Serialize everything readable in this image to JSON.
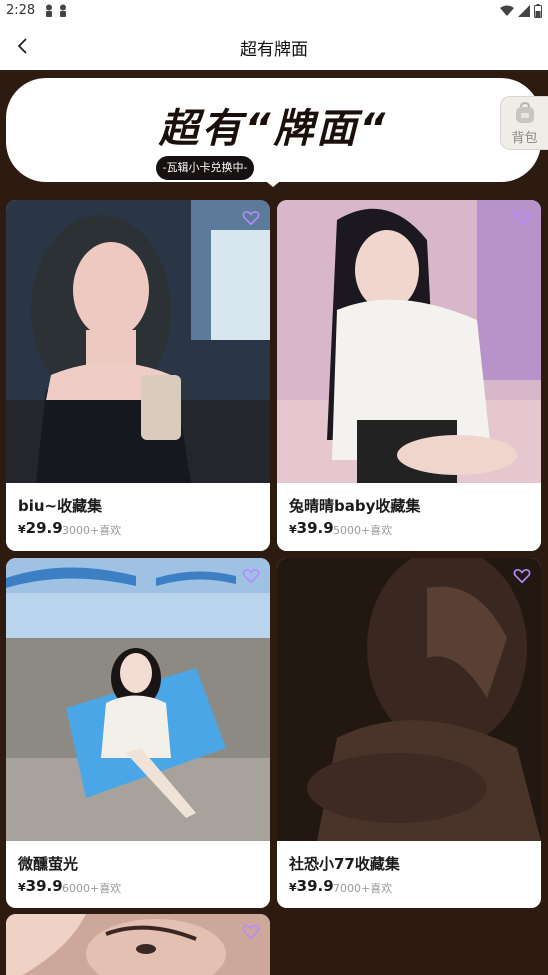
{
  "status": {
    "time": "2:28"
  },
  "header": {
    "title": "超有牌面"
  },
  "banner": {
    "title": "超有“牌面“",
    "pill": "-瓦辑小卡兑换中-"
  },
  "backpack": {
    "label": "背包"
  },
  "products": [
    {
      "name": "biu~收藏集",
      "currency": "¥",
      "price": "29.9",
      "likes": "3000+喜欢"
    },
    {
      "name": "兔晴晴baby收藏集",
      "currency": "¥",
      "price": "39.9",
      "likes": "5000+喜欢"
    },
    {
      "name": "微醺萤光",
      "currency": "¥",
      "price": "39.9",
      "likes": "6000+喜欢"
    },
    {
      "name": "社恐小77收藏集",
      "currency": "¥",
      "price": "39.9",
      "likes": "7000+喜欢"
    }
  ],
  "colors": {
    "heart": "#b48cff",
    "background": "#2d1b12"
  },
  "icons": [
    "back-arrow-icon",
    "heart-icon",
    "backpack-icon",
    "wifi-icon",
    "signal-icon",
    "battery-icon"
  ]
}
